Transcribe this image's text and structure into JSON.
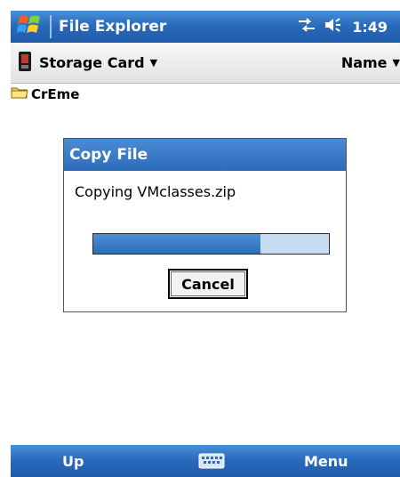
{
  "titlebar": {
    "app_title": "File Explorer",
    "time": "1:49",
    "icons": [
      "windows-flag-icon",
      "connectivity-icon",
      "volume-icon"
    ]
  },
  "location": {
    "folder": "Storage Card",
    "sort": "Name"
  },
  "files": [
    {
      "name": "CrEme",
      "icon": "folder-icon"
    }
  ],
  "dialog": {
    "title": "Copy File",
    "message": "Copying VMclasses.zip",
    "progress_fraction": 0.71,
    "cancel_label": "Cancel"
  },
  "menubar": {
    "left_softkey": "Up",
    "right_softkey": "Menu",
    "center_icon": "keyboard-icon"
  },
  "colors": {
    "bar_blue": "#2a6bbd",
    "progress_track": "#c7dcf1",
    "progress_fill": "#2d6cba"
  }
}
